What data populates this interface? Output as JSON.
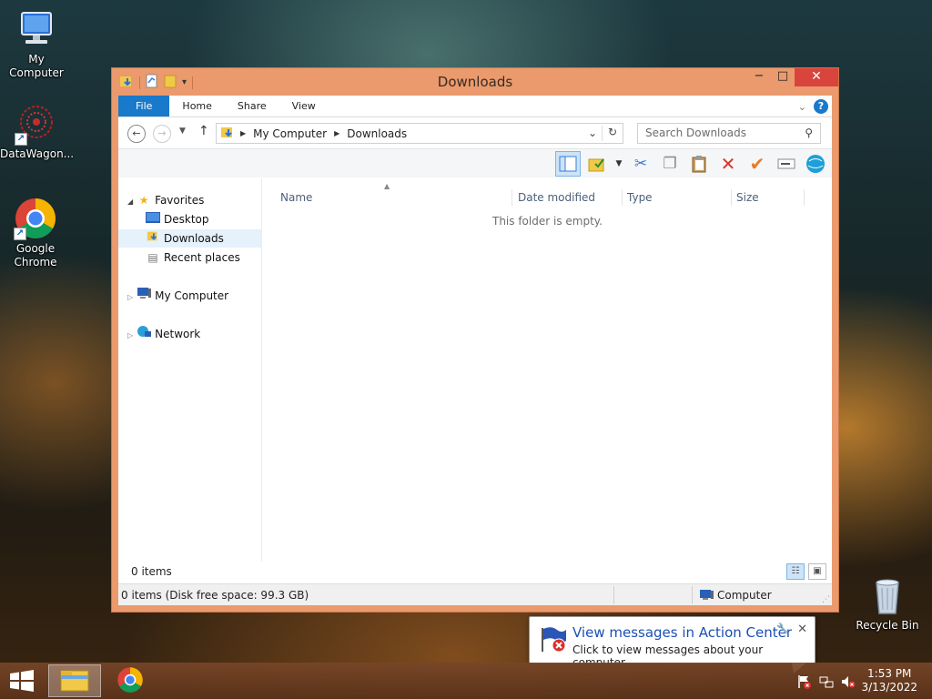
{
  "desktop": {
    "icons": [
      {
        "label": "My Computer",
        "icon": "computer-icon"
      },
      {
        "label": "DataWagon...",
        "icon": "datawagon-icon"
      },
      {
        "label": "Google Chrome",
        "icon": "chrome-icon"
      },
      {
        "label": "Recycle Bin",
        "icon": "recycle-bin-icon"
      }
    ]
  },
  "window": {
    "title": "Downloads",
    "controls": {
      "minimize": "−",
      "maximize": "□",
      "close": "✕"
    },
    "ribbon_tabs": [
      "File",
      "Home",
      "Share",
      "View"
    ],
    "address": {
      "crumbs": [
        "My Computer",
        "Downloads"
      ]
    },
    "search": {
      "placeholder": "Search Downloads"
    },
    "nav_pane": {
      "favorites": "Favorites",
      "favorites_items": [
        "Desktop",
        "Downloads",
        "Recent places"
      ],
      "my_computer": "My Computer",
      "network": "Network"
    },
    "columns": [
      "Name",
      "Date modified",
      "Type",
      "Size"
    ],
    "empty_message": "This folder is empty.",
    "items_count": "0 items",
    "status": {
      "left": "0 items (Disk free space: 99.3 GB)",
      "right": "Computer"
    }
  },
  "taskbar": {
    "apps": [
      "file-explorer-icon",
      "chrome-icon"
    ],
    "clock": {
      "time": "1:53 PM",
      "date": "3/13/2022"
    }
  },
  "notification": {
    "title": "View messages in Action Center",
    "subtitle": "Click to view messages about your computer."
  },
  "colors": {
    "window_frame": "#ea9a6d",
    "accent_blue": "#1979ca",
    "close_red": "#d9443c"
  }
}
